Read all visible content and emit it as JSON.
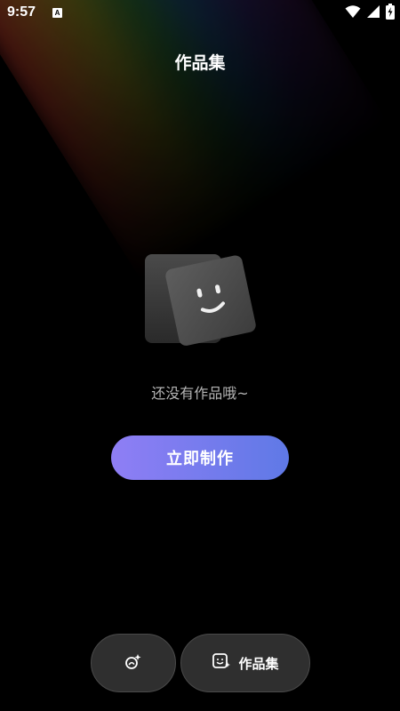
{
  "status_bar": {
    "time": "9:57",
    "notification_icon": "A"
  },
  "header": {
    "title": "作品集"
  },
  "empty_state": {
    "illustration": "smiley-cards-icon",
    "message": "还没有作品哦~"
  },
  "actions": {
    "create_label": "立即制作"
  },
  "bottom_nav": {
    "left_icon": "creation-icon",
    "right_icon": "gallery-icon",
    "right_label": "作品集"
  },
  "colors": {
    "background": "#000000",
    "button_gradient_start": "#8f7ef5",
    "button_gradient_end": "#5f79e6",
    "nav_button_bg": "#2f2f2f"
  }
}
